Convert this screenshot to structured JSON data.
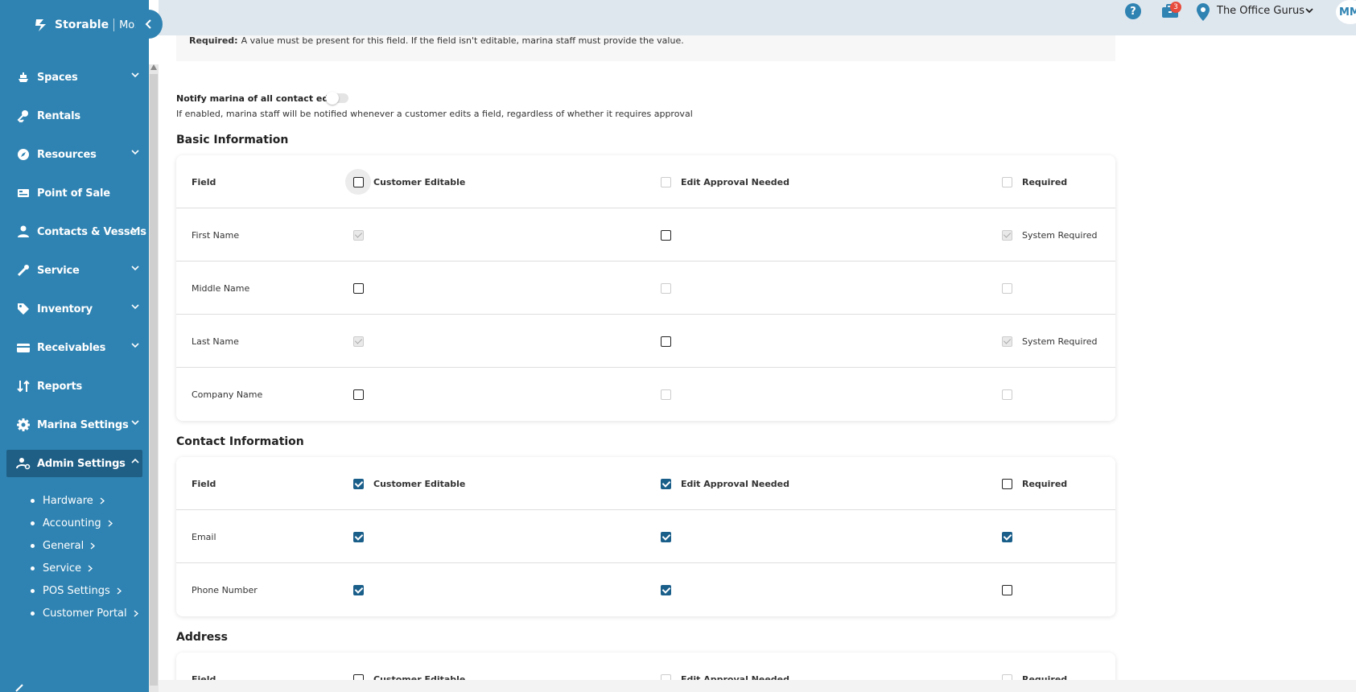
{
  "brand": {
    "name": "Storable",
    "product": "Molo"
  },
  "sidebar": {
    "items": [
      {
        "label": "Spaces",
        "icon": "ship-icon",
        "has_chevron": true
      },
      {
        "label": "Rentals",
        "icon": "key-icon",
        "has_chevron": false
      },
      {
        "label": "Resources",
        "icon": "compass-icon",
        "has_chevron": true
      },
      {
        "label": "Point of Sale",
        "icon": "register-icon",
        "has_chevron": false
      },
      {
        "label": "Contacts & Vessels",
        "icon": "user-icon",
        "has_chevron": true
      },
      {
        "label": "Service",
        "icon": "wrench-icon",
        "has_chevron": true
      },
      {
        "label": "Inventory",
        "icon": "tag-icon",
        "has_chevron": true
      },
      {
        "label": "Receivables",
        "icon": "card-icon",
        "has_chevron": true
      },
      {
        "label": "Reports",
        "icon": "sort-icon",
        "has_chevron": false
      },
      {
        "label": "Marina Settings",
        "icon": "gear-icon",
        "has_chevron": true
      },
      {
        "label": "Admin Settings",
        "icon": "user-cog-icon",
        "has_chevron": true
      }
    ],
    "sub_items": [
      {
        "label": "Hardware"
      },
      {
        "label": "Accounting"
      },
      {
        "label": "General"
      },
      {
        "label": "Service"
      },
      {
        "label": "POS Settings"
      },
      {
        "label": "Customer Portal"
      }
    ]
  },
  "topbar": {
    "help": "?",
    "notification_count": "3",
    "organization": "The Office Gurus",
    "avatar_initials": "MM"
  },
  "info": {
    "required_label": "Required:",
    "required_text": "A value must be present for this field. If the field isn't editable, marina staff must provide the value."
  },
  "notify": {
    "label": "Notify marina of all contact edits",
    "description": "If enabled, marina staff will be notified whenever a customer edits a field, regardless of whether it requires approval",
    "enabled": false
  },
  "headers": {
    "field": "Field",
    "customer_editable": "Customer Editable",
    "edit_approval": "Edit Approval Needed",
    "required": "Required"
  },
  "sections": [
    {
      "title": "Basic Information",
      "header_states": [
        "unchecked",
        "disabled",
        "disabled"
      ],
      "rows": [
        {
          "field": "First Name",
          "states": [
            "disabled-checked",
            "unchecked",
            "disabled-checked"
          ],
          "note": "System Required"
        },
        {
          "field": "Middle Name",
          "states": [
            "unchecked",
            "disabled",
            "disabled"
          ],
          "note": ""
        },
        {
          "field": "Last Name",
          "states": [
            "disabled-checked",
            "unchecked",
            "disabled-checked"
          ],
          "note": "System Required"
        },
        {
          "field": "Company Name",
          "states": [
            "unchecked",
            "disabled",
            "disabled"
          ],
          "note": ""
        }
      ]
    },
    {
      "title": "Contact Information",
      "header_states": [
        "checked",
        "checked",
        "unchecked"
      ],
      "rows": [
        {
          "field": "Email",
          "states": [
            "checked",
            "checked",
            "checked"
          ],
          "note": ""
        },
        {
          "field": "Phone Number",
          "states": [
            "checked",
            "checked",
            "unchecked"
          ],
          "note": ""
        }
      ]
    },
    {
      "title": "Address",
      "header_states": [
        "unchecked",
        "disabled",
        "disabled"
      ],
      "rows": []
    }
  ],
  "colors": {
    "sidebar": "#2f83b2",
    "active": "#1f5f86",
    "checkbox": "#1a5e8a",
    "badge": "#e74c3c"
  }
}
